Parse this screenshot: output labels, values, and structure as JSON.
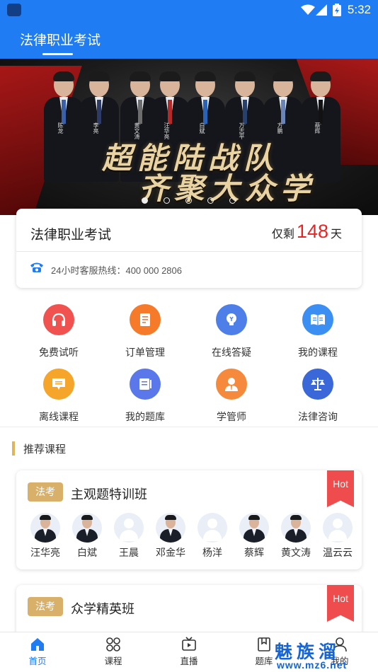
{
  "status_bar": {
    "time": "5:32"
  },
  "header": {
    "title": "法律职业考试"
  },
  "banner": {
    "names": [
      "陈龙",
      "李亮",
      "黄文涛",
      "汪华亮",
      "白斌",
      "万志平",
      "方鹏",
      "蔡辉"
    ],
    "slogan_line1": "超能陆战队",
    "slogan_line2": "齐聚大众学",
    "pager_count": 5,
    "pager_active": 0
  },
  "exam_card": {
    "title": "法律职业考试",
    "remain_prefix": "仅剩",
    "remain_days": "148",
    "remain_suffix": "天",
    "hotline": "24小时客服热线：400 000 2806"
  },
  "menu": [
    {
      "label": "免费试听",
      "icon": "headphones-icon",
      "color": "#f0524f"
    },
    {
      "label": "订单管理",
      "icon": "order-icon",
      "color": "#f57a2a"
    },
    {
      "label": "在线答疑",
      "icon": "lightbulb-icon",
      "color": "#4e7fe8"
    },
    {
      "label": "我的课程",
      "icon": "book-icon",
      "color": "#3c8ff2"
    },
    {
      "label": "离线课程",
      "icon": "download-icon",
      "color": "#f4a52a"
    },
    {
      "label": "我的题库",
      "icon": "question-bank-icon",
      "color": "#5a78ea"
    },
    {
      "label": "学管师",
      "icon": "tutor-icon",
      "color": "#f58a3c"
    },
    {
      "label": "法律咨询",
      "icon": "scales-icon",
      "color": "#3a68d8"
    }
  ],
  "section_title": "推荐课程",
  "courses": [
    {
      "tag": "法考",
      "name": "主观题特训班",
      "badge": "Hot",
      "teachers": [
        "汪华亮",
        "白斌",
        "王晨",
        "邓金华",
        "杨洋",
        "蔡辉",
        "黄文涛",
        "温云云"
      ]
    },
    {
      "tag": "法考",
      "name": "众学精英班",
      "badge": "Hot"
    }
  ],
  "tabs": [
    {
      "label": "首页",
      "icon": "home-icon"
    },
    {
      "label": "课程",
      "icon": "course-icon"
    },
    {
      "label": "直播",
      "icon": "live-icon"
    },
    {
      "label": "题库",
      "icon": "bank-icon"
    },
    {
      "label": "我的",
      "icon": "profile-icon"
    }
  ],
  "watermark": {
    "text": "魅族溜",
    "url": "www.mz6.net"
  }
}
